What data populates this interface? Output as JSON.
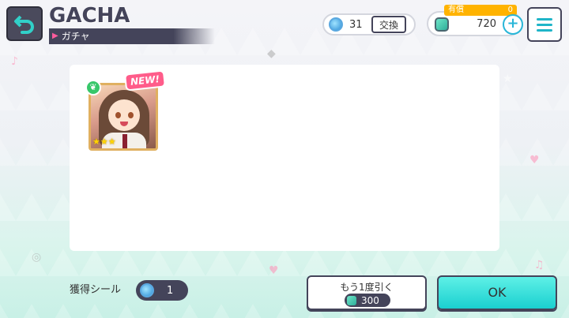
{
  "header": {
    "title": "GACHA",
    "subtitle": "ガチャ"
  },
  "currency": {
    "tickets": "31",
    "exchange_label": "交換",
    "paid_label": "有償",
    "paid_count": "0",
    "gems": "720",
    "plus_label": "+"
  },
  "result": {
    "new_label": "NEW!",
    "stars": "★★★",
    "attribute_icon": "leaf-icon"
  },
  "footer": {
    "seal_label": "獲得シール",
    "seal_count": "1",
    "again_label": "もう1度引く",
    "again_cost": "300",
    "ok_label": "OK"
  },
  "colors": {
    "accent": "#1ad0d0",
    "dark": "#44445a",
    "new_badge": "#ff5c8a",
    "paid_tag": "#ffb300"
  }
}
